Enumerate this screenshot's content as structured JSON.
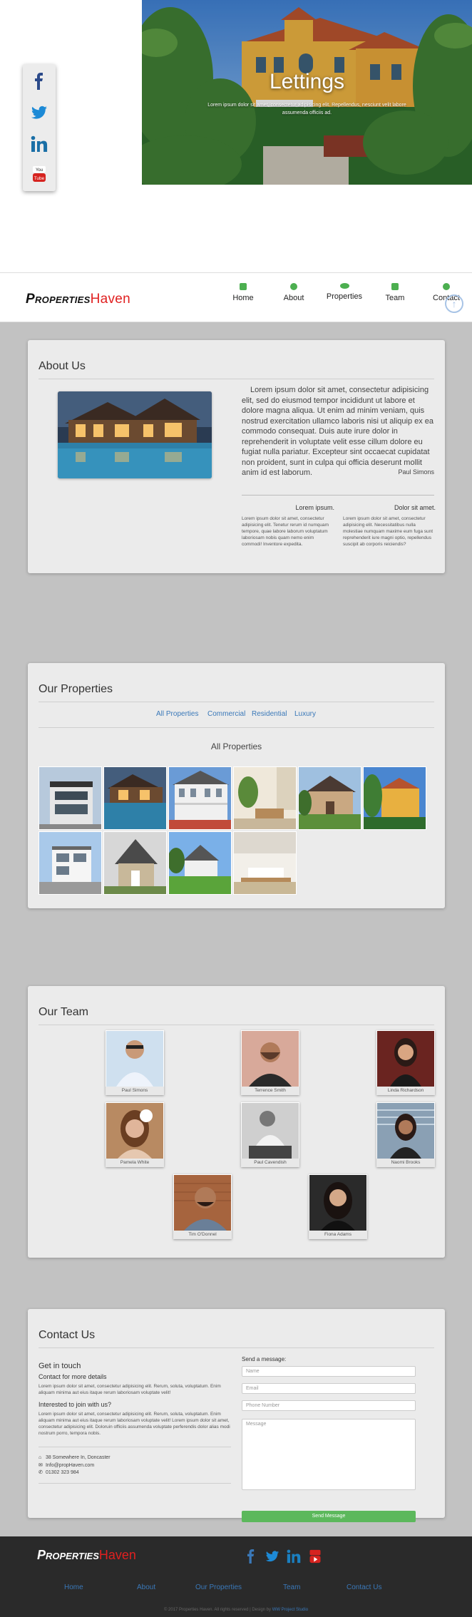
{
  "social": {
    "items": [
      "facebook-icon",
      "twitter-icon",
      "linkedin-icon",
      "youtube-icon"
    ]
  },
  "hero": {
    "title": "Lettings",
    "text": "Lorem ipsum dolor sit amet, consectetur adipisicing elit. Repellendus, nesciunt velit labore assumenda officiis ad."
  },
  "navbar": {
    "brand_part1": "Properties",
    "brand_part2": "Haven",
    "items": [
      {
        "label": "Home",
        "icon": "home-icon"
      },
      {
        "label": "About",
        "icon": "info-icon"
      },
      {
        "label": "Properties",
        "icon": "eye-icon"
      },
      {
        "label": "Team",
        "icon": "user-icon"
      },
      {
        "label": "Contact",
        "icon": "chat-icon"
      }
    ],
    "back_to_top": "↑"
  },
  "about": {
    "title": "About Us",
    "text": "Lorem ipsum dolor sit amet, consectetur adipisicing elit, sed do eiusmod tempor incididunt ut labore et dolore magna aliqua. Ut enim ad minim veniam, quis nostrud exercitation ullamco laboris nisi ut aliquip ex ea commodo consequat. Duis aute irure dolor in reprehenderit in voluptate velit esse cillum dolore eu fugiat nulla pariatur. Excepteur sint occaecat cupidatat non proident, sunt in culpa qui officia deserunt mollit anim id est laborum.",
    "author": "Paul Simons",
    "col1": {
      "heading": "Lorem ipsum.",
      "text": "Lorem ipsum dolor sit amet, consectetur adipisicing elit. Tenetur rerum id numquam tempore, quae labore laborum voluptatum laboriosam nobis quam nemo enim commodi! Inventore expedita."
    },
    "col2": {
      "heading": "Dolor sit amet.",
      "text": "Lorem ipsum dolor sit amet, consectetur adipisicing elit. Necessitatibus nulla molestiae numquam maxime eum fuga sunt reprehenderit iure magni optio, repellendus suscipit ab corporis reiciendis?"
    }
  },
  "properties": {
    "title": "Our Properties",
    "filters": [
      "All Properties",
      "Commercial",
      "Residential",
      "Luxury"
    ],
    "heading": "All Properties"
  },
  "team": {
    "title": "Our Team",
    "members": [
      "Paul Simons",
      "Terrence Smith",
      "Linda Richardson",
      "Pamela White",
      "Paul Cavendish",
      "Naomi Brooks",
      "Tim O'Donnel",
      "Fiona Adams"
    ]
  },
  "contact": {
    "title": "Contact Us",
    "get_in_touch": "Get in touch",
    "more_details": "Contact for more details",
    "text1": "Lorem ipsum dolor sit amet, consectetur adipisicing elit. Rerum, soluta, voluptatum. Enim aliquam minima aut eius itaque rerum laboriosam voluptate velit!",
    "join": "Interested to join with us?",
    "text2": "Lorem ipsum dolor sit amet, consectetur adipisicing elit. Rerum, soluta, voluptatum. Enim aliquam minima aut eius itaque rerum laboriosam voluptate velit! Lorem ipsum dolor sit amet, consectetur adipisicing elit. Doloruin officiis assumenda voluptate perferendis dolor alias modi nostrum porro, tempora nobis.",
    "address": "38 Somewhere In, Doncaster",
    "email": "Info@propHaven.com",
    "phone": "01302 323 984",
    "send_label": "Send a message:",
    "name_ph": "Name",
    "email_ph": "Email",
    "phone_ph": "Phone Number",
    "message_ph": "Message",
    "send_button": "Send Message"
  },
  "footer": {
    "brand_part1": "Properties",
    "brand_part2": "Haven",
    "links": [
      "Home",
      "About",
      "Our Properties",
      "Team",
      "Contact Us"
    ],
    "copyright": "© 2017 Properties Haven. All rights reserved | Design by",
    "studio": "WW Project Studio"
  },
  "colors": {
    "accent": "#3a78b8",
    "brand_red": "#e02020",
    "nav_icon": "#4caf50",
    "send": "#5cb85c",
    "footer_bg": "#2a2a2a"
  }
}
